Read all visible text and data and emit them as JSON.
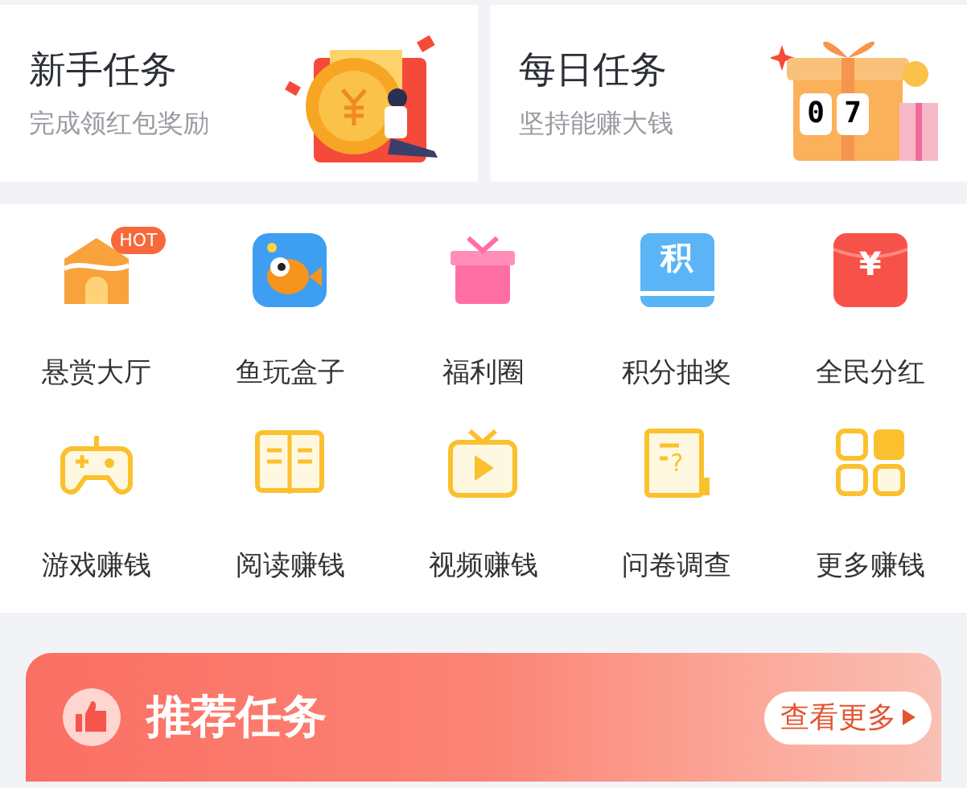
{
  "task_cards": [
    {
      "kind": "newbie",
      "title": "新手任务",
      "subtitle": "完成领红包奖励"
    },
    {
      "kind": "daily",
      "title": "每日任务",
      "subtitle": "坚持能赚大钱",
      "digits": [
        "0",
        "7"
      ]
    }
  ],
  "grid_items": [
    {
      "kind": "house",
      "label": "悬赏大厅",
      "badge": "HOT"
    },
    {
      "kind": "fish",
      "label": "鱼玩盒子"
    },
    {
      "kind": "gift",
      "label": "福利圈"
    },
    {
      "kind": "points",
      "label": "积分抽奖",
      "icon_text": "积"
    },
    {
      "kind": "envelope",
      "label": "全民分红",
      "icon_text": "¥"
    },
    {
      "kind": "gamepad",
      "label": "游戏赚钱"
    },
    {
      "kind": "book",
      "label": "阅读赚钱"
    },
    {
      "kind": "tv",
      "label": "视频赚钱"
    },
    {
      "kind": "survey",
      "label": "问卷调查",
      "icon_text": "?"
    },
    {
      "kind": "grid",
      "label": "更多赚钱"
    }
  ],
  "recommend": {
    "title": "推荐任务",
    "more_button": "查看更多"
  }
}
